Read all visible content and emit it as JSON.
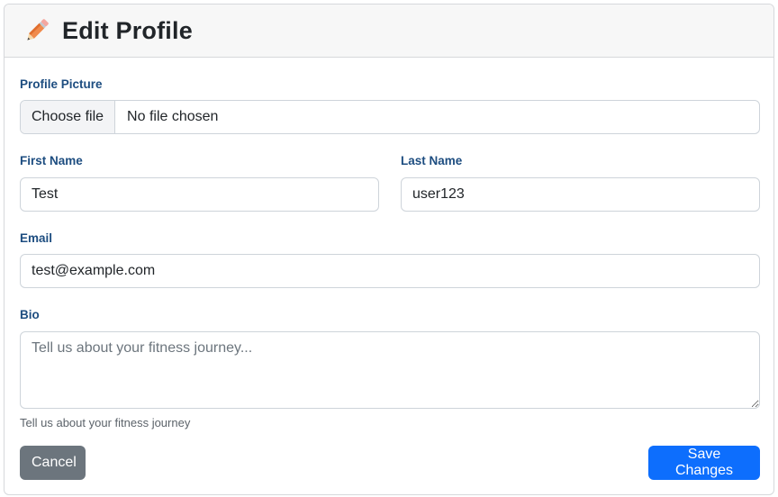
{
  "header": {
    "title": "Edit Profile",
    "icon": "pencil-icon"
  },
  "form": {
    "profile_picture": {
      "label": "Profile Picture",
      "button": "Choose file",
      "status": "No file chosen"
    },
    "first_name": {
      "label": "First Name",
      "value": "Test"
    },
    "last_name": {
      "label": "Last Name",
      "value": "user123"
    },
    "email": {
      "label": "Email",
      "value": "test@example.com"
    },
    "bio": {
      "label": "Bio",
      "placeholder": "Tell us about your fitness journey...",
      "help": "Tell us about your fitness journey"
    }
  },
  "actions": {
    "cancel_label": "Cancel",
    "save_label": "Save Changes"
  },
  "colors": {
    "primary": "#0d6efd",
    "secondary": "#6c757d",
    "label": "#1d4d80"
  }
}
